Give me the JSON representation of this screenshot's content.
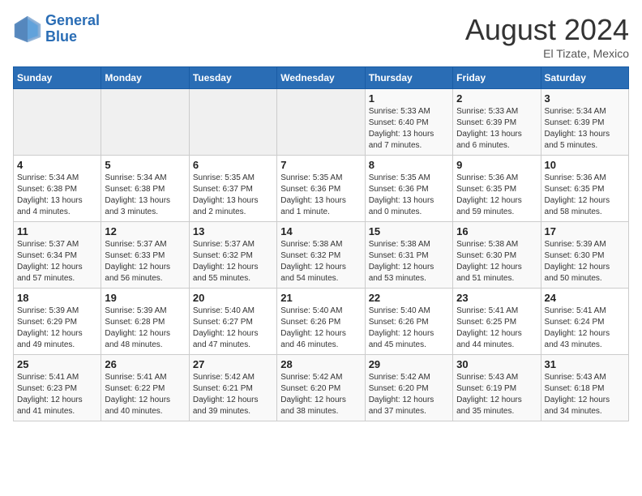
{
  "header": {
    "logo_line1": "General",
    "logo_line2": "Blue",
    "month_year": "August 2024",
    "location": "El Tizate, Mexico"
  },
  "weekdays": [
    "Sunday",
    "Monday",
    "Tuesday",
    "Wednesday",
    "Thursday",
    "Friday",
    "Saturday"
  ],
  "weeks": [
    [
      {
        "day": "",
        "info": ""
      },
      {
        "day": "",
        "info": ""
      },
      {
        "day": "",
        "info": ""
      },
      {
        "day": "",
        "info": ""
      },
      {
        "day": "1",
        "info": "Sunrise: 5:33 AM\nSunset: 6:40 PM\nDaylight: 13 hours and 7 minutes."
      },
      {
        "day": "2",
        "info": "Sunrise: 5:33 AM\nSunset: 6:39 PM\nDaylight: 13 hours and 6 minutes."
      },
      {
        "day": "3",
        "info": "Sunrise: 5:34 AM\nSunset: 6:39 PM\nDaylight: 13 hours and 5 minutes."
      }
    ],
    [
      {
        "day": "4",
        "info": "Sunrise: 5:34 AM\nSunset: 6:38 PM\nDaylight: 13 hours and 4 minutes."
      },
      {
        "day": "5",
        "info": "Sunrise: 5:34 AM\nSunset: 6:38 PM\nDaylight: 13 hours and 3 minutes."
      },
      {
        "day": "6",
        "info": "Sunrise: 5:35 AM\nSunset: 6:37 PM\nDaylight: 13 hours and 2 minutes."
      },
      {
        "day": "7",
        "info": "Sunrise: 5:35 AM\nSunset: 6:36 PM\nDaylight: 13 hours and 1 minute."
      },
      {
        "day": "8",
        "info": "Sunrise: 5:35 AM\nSunset: 6:36 PM\nDaylight: 13 hours and 0 minutes."
      },
      {
        "day": "9",
        "info": "Sunrise: 5:36 AM\nSunset: 6:35 PM\nDaylight: 12 hours and 59 minutes."
      },
      {
        "day": "10",
        "info": "Sunrise: 5:36 AM\nSunset: 6:35 PM\nDaylight: 12 hours and 58 minutes."
      }
    ],
    [
      {
        "day": "11",
        "info": "Sunrise: 5:37 AM\nSunset: 6:34 PM\nDaylight: 12 hours and 57 minutes."
      },
      {
        "day": "12",
        "info": "Sunrise: 5:37 AM\nSunset: 6:33 PM\nDaylight: 12 hours and 56 minutes."
      },
      {
        "day": "13",
        "info": "Sunrise: 5:37 AM\nSunset: 6:32 PM\nDaylight: 12 hours and 55 minutes."
      },
      {
        "day": "14",
        "info": "Sunrise: 5:38 AM\nSunset: 6:32 PM\nDaylight: 12 hours and 54 minutes."
      },
      {
        "day": "15",
        "info": "Sunrise: 5:38 AM\nSunset: 6:31 PM\nDaylight: 12 hours and 53 minutes."
      },
      {
        "day": "16",
        "info": "Sunrise: 5:38 AM\nSunset: 6:30 PM\nDaylight: 12 hours and 51 minutes."
      },
      {
        "day": "17",
        "info": "Sunrise: 5:39 AM\nSunset: 6:30 PM\nDaylight: 12 hours and 50 minutes."
      }
    ],
    [
      {
        "day": "18",
        "info": "Sunrise: 5:39 AM\nSunset: 6:29 PM\nDaylight: 12 hours and 49 minutes."
      },
      {
        "day": "19",
        "info": "Sunrise: 5:39 AM\nSunset: 6:28 PM\nDaylight: 12 hours and 48 minutes."
      },
      {
        "day": "20",
        "info": "Sunrise: 5:40 AM\nSunset: 6:27 PM\nDaylight: 12 hours and 47 minutes."
      },
      {
        "day": "21",
        "info": "Sunrise: 5:40 AM\nSunset: 6:26 PM\nDaylight: 12 hours and 46 minutes."
      },
      {
        "day": "22",
        "info": "Sunrise: 5:40 AM\nSunset: 6:26 PM\nDaylight: 12 hours and 45 minutes."
      },
      {
        "day": "23",
        "info": "Sunrise: 5:41 AM\nSunset: 6:25 PM\nDaylight: 12 hours and 44 minutes."
      },
      {
        "day": "24",
        "info": "Sunrise: 5:41 AM\nSunset: 6:24 PM\nDaylight: 12 hours and 43 minutes."
      }
    ],
    [
      {
        "day": "25",
        "info": "Sunrise: 5:41 AM\nSunset: 6:23 PM\nDaylight: 12 hours and 41 minutes."
      },
      {
        "day": "26",
        "info": "Sunrise: 5:41 AM\nSunset: 6:22 PM\nDaylight: 12 hours and 40 minutes."
      },
      {
        "day": "27",
        "info": "Sunrise: 5:42 AM\nSunset: 6:21 PM\nDaylight: 12 hours and 39 minutes."
      },
      {
        "day": "28",
        "info": "Sunrise: 5:42 AM\nSunset: 6:20 PM\nDaylight: 12 hours and 38 minutes."
      },
      {
        "day": "29",
        "info": "Sunrise: 5:42 AM\nSunset: 6:20 PM\nDaylight: 12 hours and 37 minutes."
      },
      {
        "day": "30",
        "info": "Sunrise: 5:43 AM\nSunset: 6:19 PM\nDaylight: 12 hours and 35 minutes."
      },
      {
        "day": "31",
        "info": "Sunrise: 5:43 AM\nSunset: 6:18 PM\nDaylight: 12 hours and 34 minutes."
      }
    ]
  ]
}
